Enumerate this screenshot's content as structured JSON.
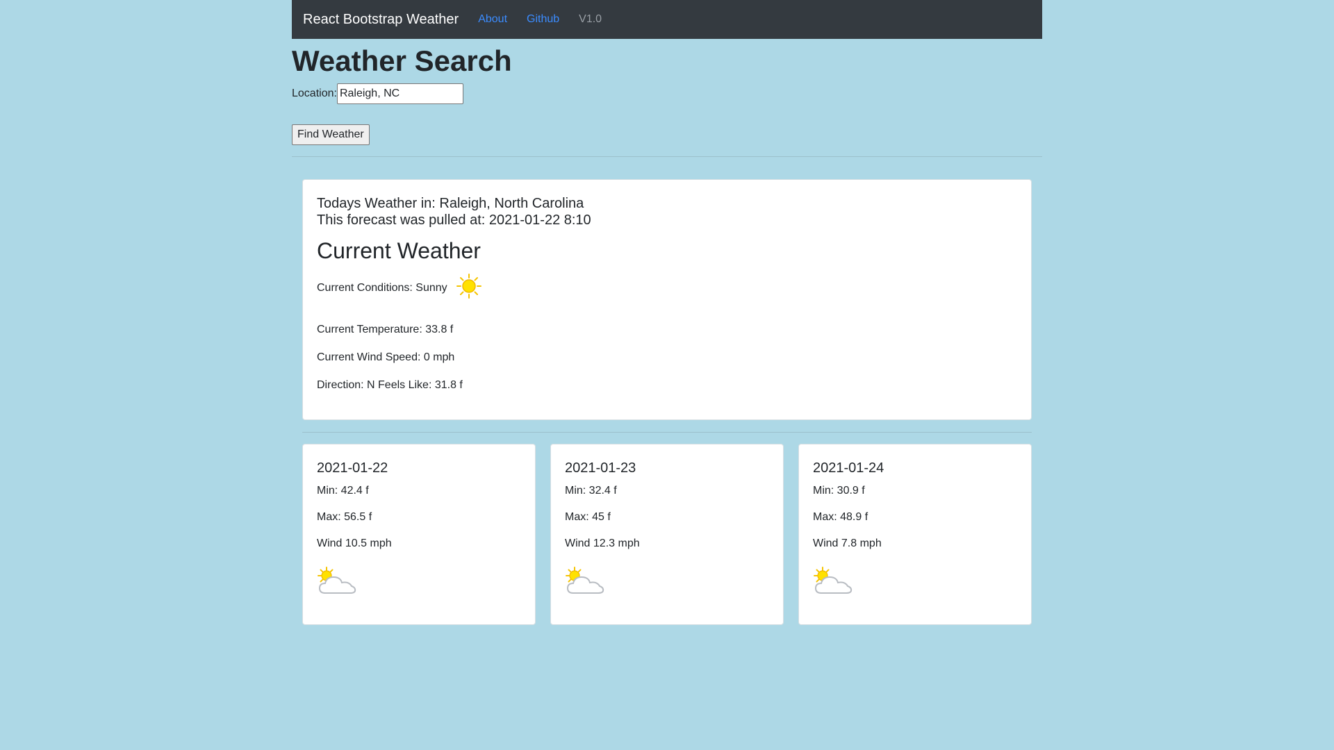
{
  "navbar": {
    "brand": "React Bootstrap Weather",
    "links": [
      "About",
      "Github"
    ],
    "version": "V1.0"
  },
  "search": {
    "title": "Weather Search",
    "location_label": "Location:",
    "location_value": "Raleigh, NC",
    "button_label": "Find Weather"
  },
  "current": {
    "location_line": "Todays Weather in: Raleigh, North Carolina",
    "pulled_line": "This forecast was pulled at: 2021-01-22 8:10",
    "title": "Current Weather",
    "conditions": "Current Conditions: Sunny",
    "conditions_icon": "sun-icon",
    "temperature": "Current Temperature: 33.8 f",
    "wind_speed": "Current Wind Speed: 0 mph",
    "direction_feels": "Direction: N Feels Like: 31.8 f"
  },
  "forecast": [
    {
      "date": "2021-01-22",
      "min": "Min: 42.4 f",
      "max": "Max: 56.5 f",
      "wind": "Wind 10.5 mph",
      "icon": "partly-cloudy-icon"
    },
    {
      "date": "2021-01-23",
      "min": "Min: 32.4 f",
      "max": "Max: 45 f",
      "wind": "Wind 12.3 mph",
      "icon": "partly-cloudy-icon"
    },
    {
      "date": "2021-01-24",
      "min": "Min: 30.9 f",
      "max": "Max: 48.9 f",
      "wind": "Wind 7.8 mph",
      "icon": "partly-cloudy-icon"
    }
  ],
  "colors": {
    "page_background": "#add8e6",
    "navbar_background": "#343a40",
    "link": "#3b8cff"
  }
}
